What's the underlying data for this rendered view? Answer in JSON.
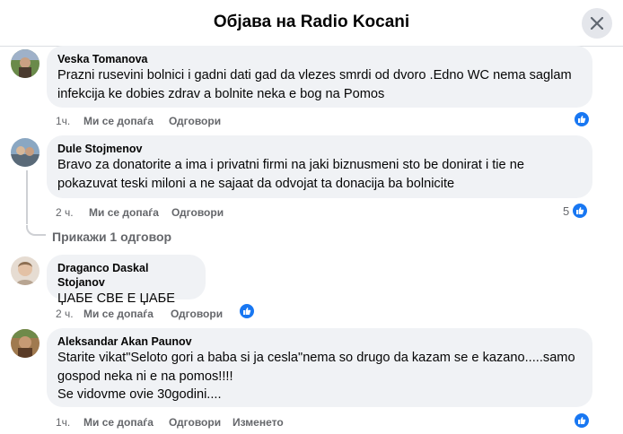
{
  "header": {
    "title": "Објава на Radio Kocani",
    "close_icon": "close-icon"
  },
  "labels": {
    "like": "Ми се допаѓа",
    "reply": "Одговори",
    "edited": "Изменето"
  },
  "comments": [
    {
      "author": "Veska Tomanova",
      "lines": [
        "Prazni rusevini bolnici i gadni dati gad da vlezes smrdi od dvoro .Edno WC nema saglam",
        "infekcija ke dobies zdrav a bolnite neka e bog na Pomos"
      ],
      "time": "1ч.",
      "reaction_count": ""
    },
    {
      "author": "Dule Stojmenov",
      "lines": [
        "Bravo za donatorite a ima i privatni firmi na jaki biznusmeni sto be donirat i tie ne",
        "pokazuvat teski miloni a ne sajaat da odvojat ta donacija ba bolnicite"
      ],
      "time": "2 ч.",
      "reaction_count": "5",
      "replies_link": "Прикажи 1 одговор"
    },
    {
      "author": "Draganco Daskal Stojanov",
      "lines": [
        "ЏАБЕ СВЕ Е ЏАБЕ"
      ],
      "time": "2 ч.",
      "reaction_count": ""
    },
    {
      "author": "Aleksandar Akan Paunov",
      "lines": [
        "Starite vikat\"Seloto gori a baba si ja cesla\"nema so drugo da kazam se e kazano.....samo",
        "gospod neka ni e na pomos!!!!",
        "Se vidovme ovie 30godini...."
      ],
      "time": "1ч.",
      "reaction_count": "",
      "edited": true
    }
  ],
  "colors": {
    "like_blue": "#1877f2",
    "bubble": "#f0f2f5",
    "meta": "#65676b"
  },
  "icons": {
    "like_reaction": "like-reaction-icon",
    "avatar": "avatar"
  }
}
